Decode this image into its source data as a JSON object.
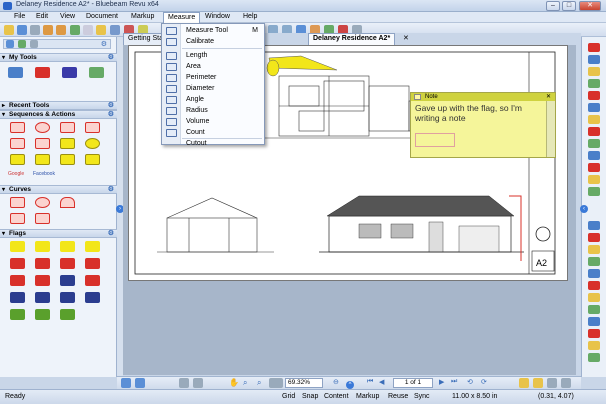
{
  "window": {
    "title": "Delaney Residence A2* - Bluebeam Revu x64",
    "min": "–",
    "max": "□",
    "close": "✕"
  },
  "menubar": [
    "File",
    "Edit",
    "View",
    "Document",
    "Markup",
    "Measure",
    "Window",
    "Help"
  ],
  "measure_menu": {
    "items": [
      {
        "label": "Measure Tool",
        "shortcut": "M",
        "icon": "ruler-icon"
      },
      {
        "label": "Calibrate",
        "shortcut": "",
        "icon": "calibrate-icon"
      },
      {
        "label": "Length",
        "shortcut": "",
        "icon": "length-icon"
      },
      {
        "label": "Area",
        "shortcut": "",
        "icon": "area-icon"
      },
      {
        "label": "Perimeter",
        "shortcut": "",
        "icon": "perimeter-icon"
      },
      {
        "label": "Diameter",
        "shortcut": "",
        "icon": "diameter-icon"
      },
      {
        "label": "Angle",
        "shortcut": "",
        "icon": "angle-icon"
      },
      {
        "label": "Radius",
        "shortcut": "",
        "icon": "radius-icon"
      },
      {
        "label": "Volume",
        "shortcut": "",
        "icon": "volume-icon"
      },
      {
        "label": "Count",
        "shortcut": "",
        "icon": "count-icon"
      },
      {
        "label": "Cutout",
        "shortcut": "",
        "icon": "cutout-icon"
      }
    ]
  },
  "tabs": {
    "getting_started": "Getting Sta",
    "document": "Delaney Residence A2*"
  },
  "left_panel": {
    "sections": [
      "My Tools",
      "Recent Tools",
      "Sequences & Actions",
      "Curves",
      "Flags"
    ],
    "stamp_labels": [
      "Google",
      "Facebook"
    ]
  },
  "note": {
    "header": "Note",
    "text": "Gave up with the flag, so I'm writing a note",
    "close": "✕"
  },
  "drawing": {
    "sheet_label": "A2"
  },
  "navbar": {
    "zoom": "69.32%",
    "page": "1 of 1"
  },
  "statusbar": {
    "ready": "Ready",
    "toggles": [
      "Grid",
      "Snap",
      "Content",
      "Markup",
      "Reuse",
      "Sync"
    ],
    "page_size": "11.00 x 8.50 in",
    "coords": "(0.31, 4.07)"
  },
  "colors": {
    "accent": "#3a79d8",
    "note": "#f5f59a",
    "flag": "#f2e61a",
    "markup_red": "#d8302a"
  }
}
